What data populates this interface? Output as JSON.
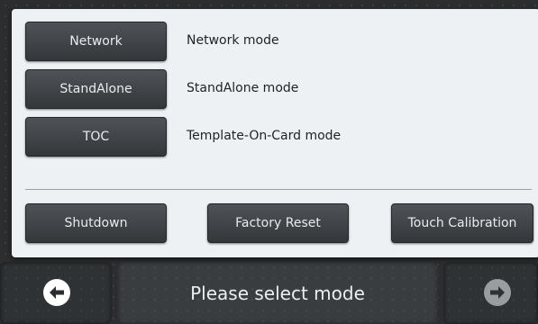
{
  "modes": [
    {
      "label": "Network",
      "description": "Network mode"
    },
    {
      "label": "StandAlone",
      "description": "StandAlone mode"
    },
    {
      "label": "TOC",
      "description": "Template-On-Card mode"
    }
  ],
  "actions": {
    "shutdown": "Shutdown",
    "factory_reset": "Factory Reset",
    "touch_calibration": "Touch Calibration"
  },
  "status": {
    "message": "Please select mode"
  },
  "nav": {
    "back_icon": "arrow-left-circle-icon",
    "forward_icon": "arrow-right-circle-icon"
  },
  "colors": {
    "panel_background": "#eef1f3",
    "button_background": "#404447",
    "back_arrow_color": "#ffffff",
    "forward_arrow_color": "#9a9da0"
  }
}
